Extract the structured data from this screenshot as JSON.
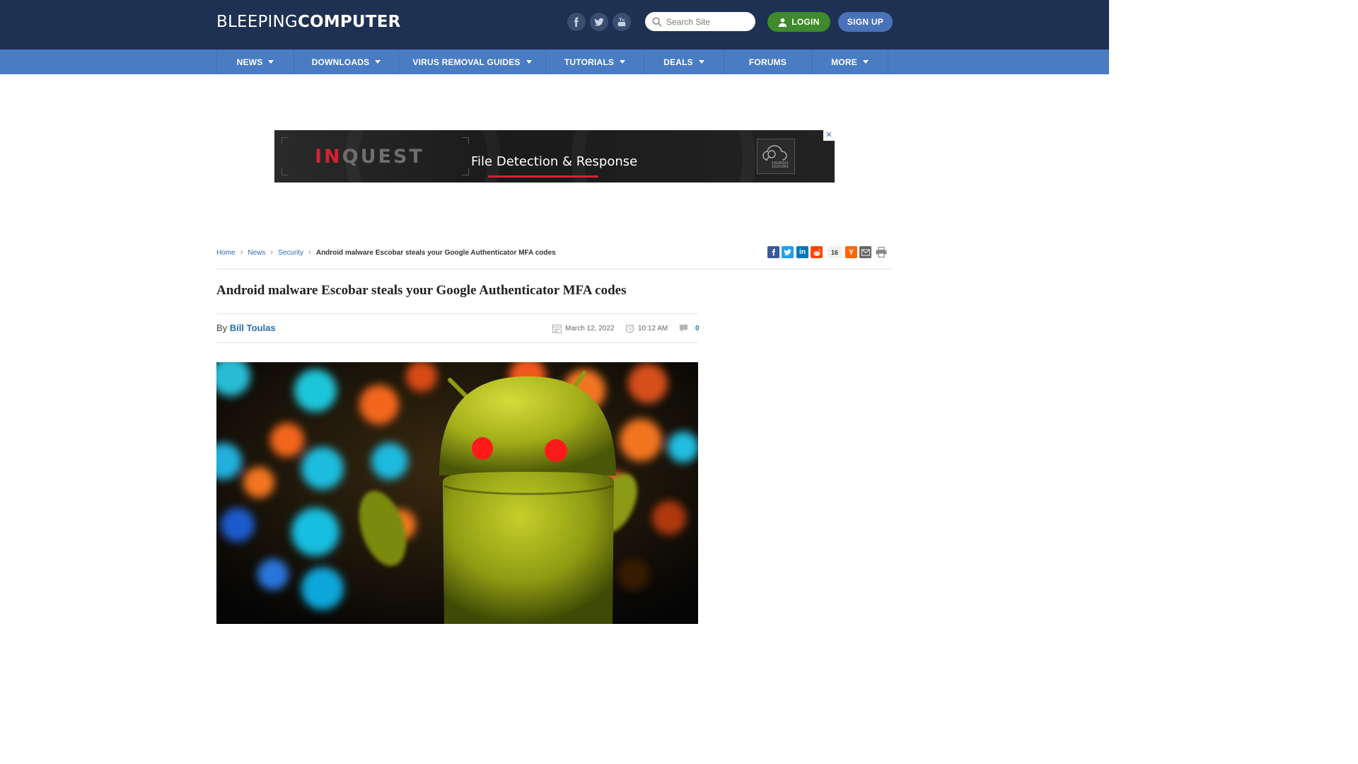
{
  "header": {
    "logo_light": "BLEEPING",
    "logo_bold": "COMPUTER",
    "social": [
      "facebook-icon",
      "twitter-icon",
      "youtube-icon"
    ],
    "search_placeholder": "Search Site",
    "login_label": "LOGIN",
    "signup_label": "SIGN UP"
  },
  "nav": {
    "items": [
      {
        "label": "NEWS",
        "dropdown": true
      },
      {
        "label": "DOWNLOADS",
        "dropdown": true
      },
      {
        "label": "VIRUS REMOVAL GUIDES",
        "dropdown": true
      },
      {
        "label": "TUTORIALS",
        "dropdown": true
      },
      {
        "label": "DEALS",
        "dropdown": true
      },
      {
        "label": "FORUMS",
        "dropdown": false
      },
      {
        "label": "MORE",
        "dropdown": true
      }
    ]
  },
  "ad": {
    "brand_in": "IN",
    "brand_rest": "QUEST",
    "tagline": "File Detection & Response",
    "close": "✕"
  },
  "breadcrumb": {
    "items": [
      "Home",
      "News",
      "Security"
    ],
    "current": "Android malware Escobar steals your Google Authenticator MFA codes"
  },
  "share": {
    "count": "16",
    "buttons": [
      "facebook-icon",
      "twitter-icon",
      "linkedin-icon",
      "reddit-icon",
      "hacker-news-icon",
      "email-icon",
      "print-icon"
    ]
  },
  "article": {
    "title": "Android malware Escobar steals your Google Authenticator MFA codes",
    "by": "By",
    "author": "Bill Toulas",
    "date": "March 12, 2022",
    "time": "10:12 AM",
    "comments": "0"
  },
  "colors": {
    "header_bg": "#1e3152",
    "nav_bg": "#4a7cc4",
    "login_green": "#3e8a2c",
    "signup_blue": "#4a72b8",
    "link_blue": "#2b6cb4",
    "ad_red": "#d32334"
  }
}
